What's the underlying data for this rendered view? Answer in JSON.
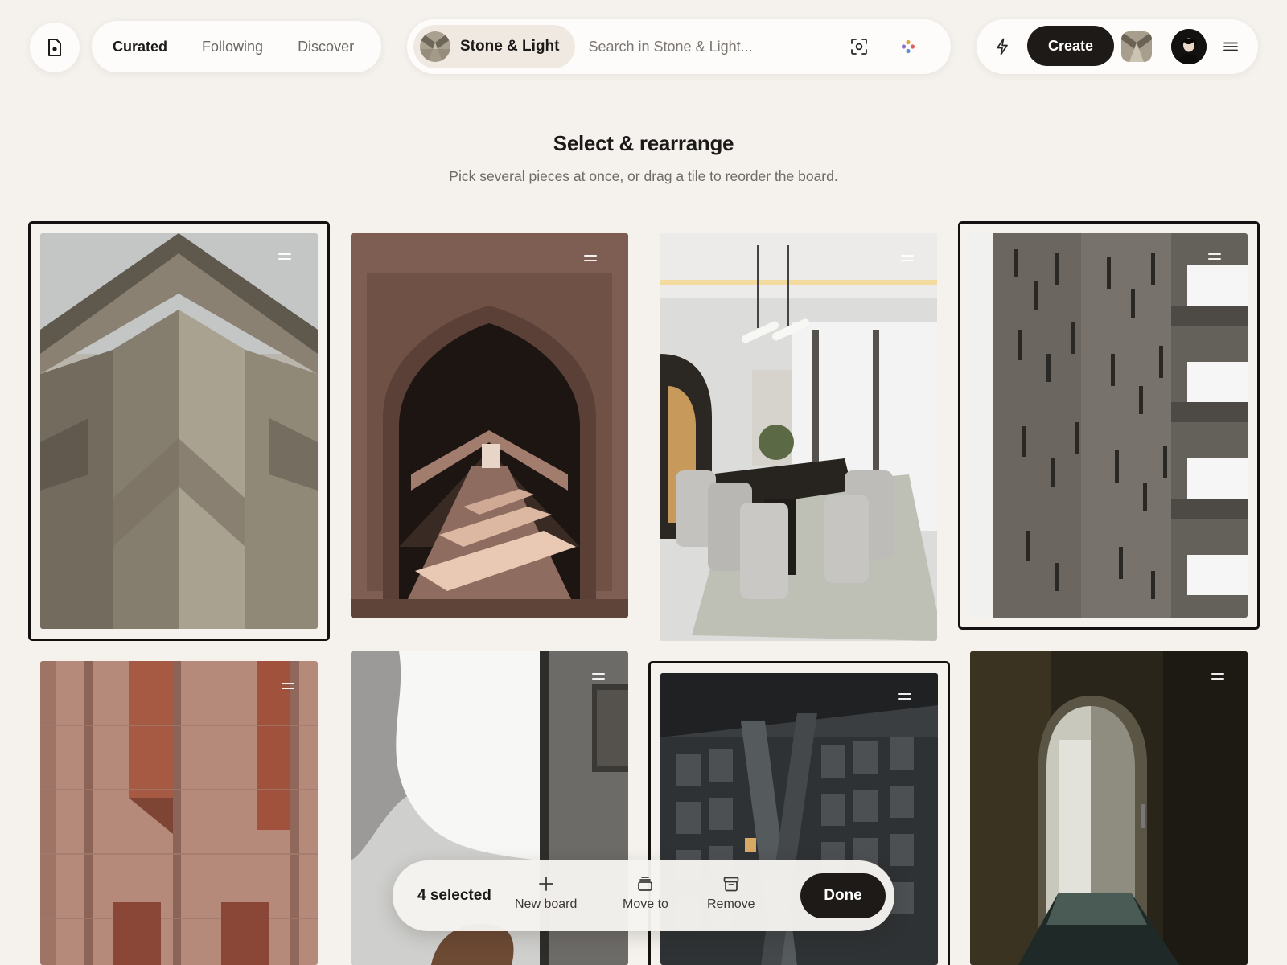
{
  "nav": {
    "tabs": [
      {
        "label": "Curated",
        "active": true
      },
      {
        "label": "Following",
        "active": false
      },
      {
        "label": "Discover",
        "active": false
      }
    ]
  },
  "search": {
    "board_label": "Stone & Light",
    "placeholder": "Search in Stone & Light..."
  },
  "actions": {
    "create_label": "Create"
  },
  "heading": {
    "title": "Select & rearrange",
    "subtitle": "Pick several pieces at once, or drag a tile to reorder the board."
  },
  "tiles": [
    {
      "subject": "concrete-chevron-facade",
      "selected": true
    },
    {
      "subject": "stone-archway-corridor",
      "selected": false
    },
    {
      "subject": "dining-room-interior",
      "selected": false
    },
    {
      "subject": "concrete-tower-windows",
      "selected": true
    },
    {
      "subject": "red-sandstone-facade",
      "selected": false
    },
    {
      "subject": "shadowed-white-wall",
      "selected": false
    },
    {
      "subject": "brutalist-building-night",
      "selected": true
    },
    {
      "subject": "dark-arched-doorway",
      "selected": false
    }
  ],
  "action_bar": {
    "count_label": "4 selected",
    "new_board_label": "New board",
    "move_to_label": "Move to",
    "remove_label": "Remove",
    "done_label": "Done"
  },
  "colors": {
    "background": "#f5f2ed",
    "accent_dark": "#1d1a17",
    "muted_text": "#6f6a65"
  }
}
